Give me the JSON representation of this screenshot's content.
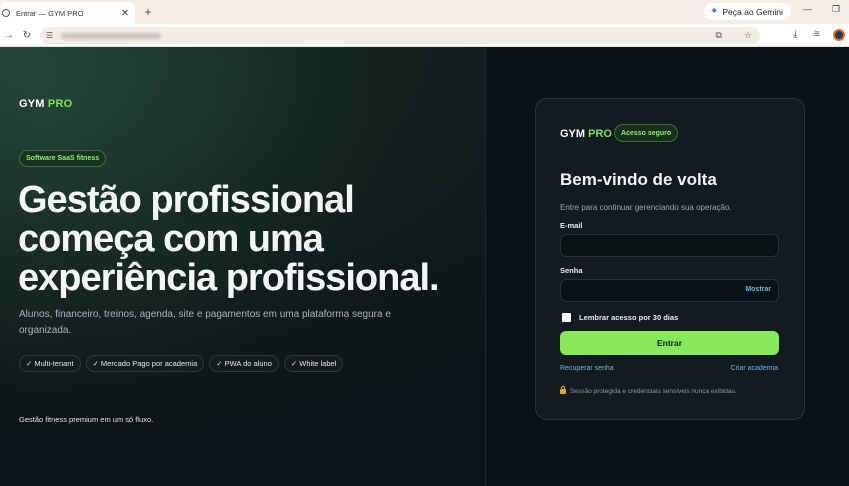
{
  "browser": {
    "tab_title": "Entrar — GYM PRO",
    "tab_close": "✕",
    "new_tab": "+",
    "gemini_label": "Peça ao Gemini",
    "minimize": "—",
    "restore": "❐"
  },
  "brand": {
    "name": "GYM",
    "suffix": "PRO"
  },
  "hero": {
    "pill": "Software SaaS fitness",
    "title": "Gestão profissional começa com uma experiência profissional.",
    "subtitle": "Alunos, financeiro, treinos, agenda, site e pagamentos em uma plataforma segura e organizada.",
    "chips": [
      "✓ Multi-tenant",
      "✓ Mercado Pago por academia",
      "✓ PWA do aluno",
      "✓ White label"
    ],
    "tagline": "Gestão fitness premium em um só fluxo."
  },
  "login": {
    "brand": "GYM",
    "brand_suffix": "PRO",
    "badge": "Acesso seguro",
    "title": "Bem-vindo de volta",
    "subtitle": "Entre para continuar gerenciando sua operação.",
    "email_label": "E-mail",
    "email_value": "",
    "password_label": "Senha",
    "password_value": "",
    "show_label": "Mostrar",
    "remember_label": "Lembrar acesso por 30 dias",
    "submit_label": "Entrar",
    "recover_link": "Recuperar senha",
    "create_link": "Criar academia",
    "secure_note": "Sessão protegida e credenciais sensíveis nunca exibidas."
  },
  "colors": {
    "accent": "#86ea5c",
    "link": "#6fb6dc",
    "background": "#0b1418"
  }
}
